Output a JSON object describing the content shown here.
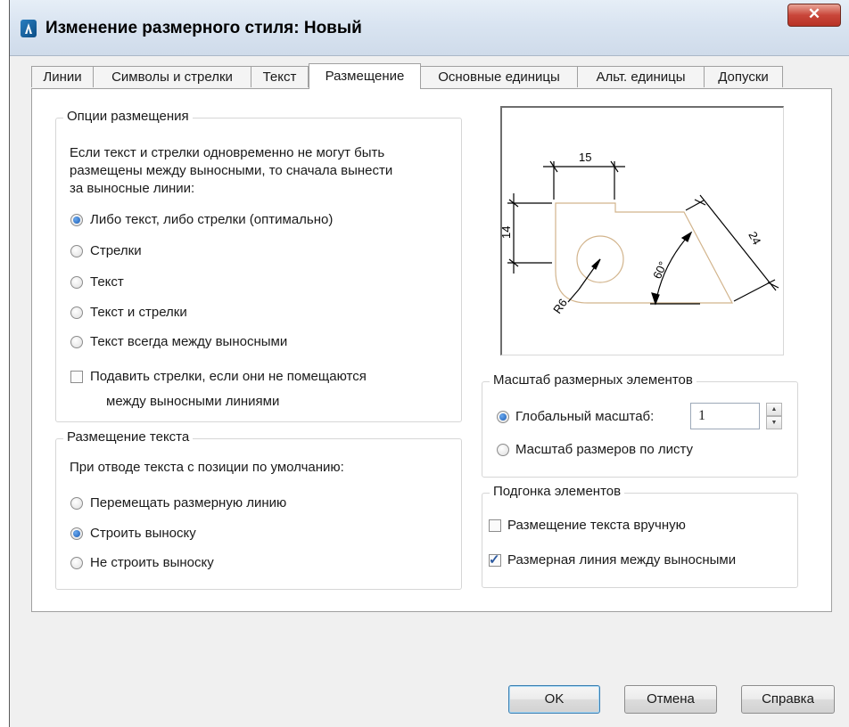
{
  "window": {
    "title": "Изменение размерного стиля: Новый",
    "close_glyph": "✕"
  },
  "tabs": [
    {
      "label": "Линии"
    },
    {
      "label": "Символы и стрелки"
    },
    {
      "label": "Текст"
    },
    {
      "label": "Размещение",
      "active": true
    },
    {
      "label": "Основные единицы"
    },
    {
      "label": "Альт. единицы"
    },
    {
      "label": "Допуски"
    }
  ],
  "fit_options": {
    "legend": "Опции размещения",
    "description": [
      "Если текст и стрелки одновременно не могут быть",
      "размещены между выносными, то сначала вынести",
      "за выносные линии:"
    ],
    "radios": [
      {
        "label": "Либо текст, либо стрелки (оптимально)",
        "checked": true
      },
      {
        "label": "Стрелки",
        "checked": false
      },
      {
        "label": "Текст",
        "checked": false
      },
      {
        "label": "Текст и стрелки",
        "checked": false
      },
      {
        "label": "Текст всегда между выносными",
        "checked": false
      }
    ],
    "suppress": {
      "line1": "Подавить стрелки, если они не помещаются",
      "line2": "между выносными линиями",
      "checked": false
    }
  },
  "text_placement": {
    "legend": "Размещение текста",
    "description": "При отводе текста с позиции по умолчанию:",
    "radios": [
      {
        "label": "Перемещать размерную линию",
        "checked": false
      },
      {
        "label": "Строить выноску",
        "checked": true
      },
      {
        "label": "Не строить выноску",
        "checked": false
      }
    ]
  },
  "preview": {
    "dim_top": "15",
    "dim_left": "14",
    "dim_diag": "24",
    "dim_angle": "60°",
    "dim_radius": "R6"
  },
  "scale": {
    "legend": "Масштаб размерных элементов",
    "global_label": "Глобальный масштаб:",
    "global_checked": true,
    "value": "1",
    "layout_label": "Масштаб размеров по листу",
    "layout_checked": false
  },
  "fine_tuning": {
    "legend": "Подгонка элементов",
    "manual": {
      "label": "Размещение текста вручную",
      "checked": false
    },
    "between": {
      "label": "Размерная линия между выносными",
      "checked": true
    }
  },
  "buttons": {
    "ok": "OK",
    "cancel": "Отмена",
    "help": "Справка"
  },
  "colors": {
    "accent": "#1a5bb5",
    "geometry": "#d2b48c",
    "dimension": "#000000"
  }
}
